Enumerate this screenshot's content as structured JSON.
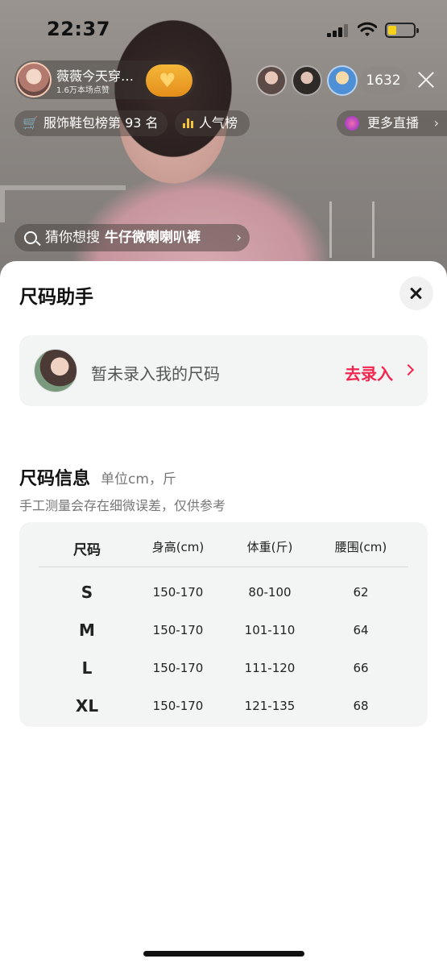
{
  "status_bar": {
    "time": "22:37"
  },
  "live": {
    "host_name": "薇薇今天穿…",
    "host_likes": "1.6万本场点赞",
    "viewer_count": "1632",
    "rank_badge": "服饰鞋包榜第 93 名",
    "popularity_badge": "人气榜",
    "more_live": "更多直播",
    "search_prefix": "猜你想搜",
    "search_keyword": "牛仔微喇喇叭裤"
  },
  "sheet": {
    "title": "尺码助手",
    "my_size": {
      "text": "暂未录入我的尺码",
      "action": "去录入"
    },
    "info": {
      "title": "尺码信息",
      "unit": "单位cm，斤",
      "note": "手工测量会存在细微误差，仅供参考"
    },
    "table": {
      "headers": [
        "尺码",
        "身高(cm)",
        "体重(斤)",
        "腰围(cm)"
      ],
      "rows": [
        [
          "S",
          "150-170",
          "80-100",
          "62"
        ],
        [
          "M",
          "150-170",
          "101-110",
          "64"
        ],
        [
          "L",
          "150-170",
          "111-120",
          "66"
        ],
        [
          "XL",
          "150-170",
          "121-135",
          "68"
        ]
      ]
    }
  },
  "colors": {
    "accent": "#f2264f",
    "card_bg": "#f3f4f4",
    "follow": "#e58f1b"
  }
}
